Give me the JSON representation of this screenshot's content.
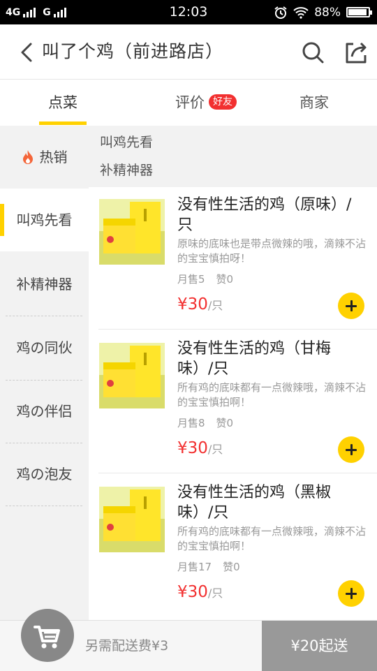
{
  "status_bar": {
    "network_left": "4G",
    "network_right": "G",
    "time": "12:03",
    "battery": "88%"
  },
  "header": {
    "title": "叫了个鸡（前进路店）"
  },
  "tabs": {
    "order": "点菜",
    "review": "评价",
    "review_badge": "好友",
    "merchant": "商家"
  },
  "sidebar": {
    "items": [
      {
        "label": "热销",
        "icon": "fire-icon"
      },
      {
        "label": "叫鸡先看"
      },
      {
        "label": "补精神器"
      },
      {
        "label": "鸡の同伙"
      },
      {
        "label": "鸡の伴侣"
      },
      {
        "label": "鸡の泡友"
      }
    ]
  },
  "sections": [
    "叫鸡先看",
    "补精神器"
  ],
  "products": [
    {
      "name": "没有性生活的鸡（原味）/只",
      "desc": "原味的底味也是带点微辣的哦，滴辣不沾的宝宝慎拍呀！",
      "sold": "月售5",
      "likes": "赞0",
      "price": "¥30",
      "unit": "/只"
    },
    {
      "name": "没有性生活的鸡（甘梅味）/只",
      "desc": "所有鸡的底味都有一点微辣哦，滴辣不沾的宝宝慎拍啊！",
      "sold": "月售8",
      "likes": "赞0",
      "price": "¥30",
      "unit": "/只"
    },
    {
      "name": "没有性生活的鸡（黑椒味）/只",
      "desc": "所有鸡的底味都有一点微辣哦，滴辣不沾的宝宝慎拍啊！",
      "sold": "月售17",
      "likes": "赞0",
      "price": "¥30",
      "unit": "/只"
    }
  ],
  "bottom_bar": {
    "delivery_fee": "另需配送费¥3",
    "min_order": "¥20起送"
  },
  "colors": {
    "accent_yellow": "#ffd100",
    "price_red": "#f23030",
    "badge_red": "#f23030"
  }
}
